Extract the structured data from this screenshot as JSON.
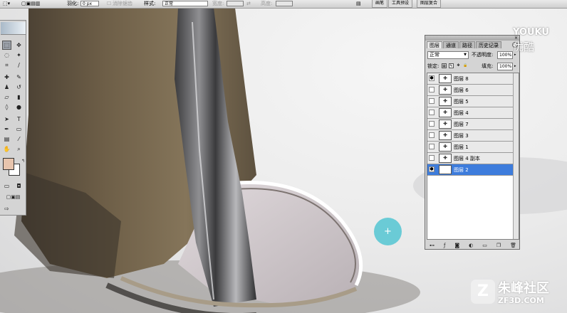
{
  "options_bar": {
    "feather_label": "羽化:",
    "feather_value": "0 px",
    "antialias_label": "消除锯齿",
    "style_label": "样式:",
    "style_value": "正常",
    "width_label": "宽度:",
    "height_label": "高度:"
  },
  "workspace_tabs": [
    "画笔",
    "工具预设",
    "图层复合"
  ],
  "layers_panel": {
    "tabs": [
      "图层",
      "通道",
      "路径",
      "历史记录"
    ],
    "blend_mode": "正常",
    "opacity_label": "不透明度:",
    "opacity_value": "100%",
    "lock_label": "锁定:",
    "fill_label": "填充:",
    "fill_value": "100%",
    "layers": [
      {
        "name": "图层 8",
        "visible": true,
        "selected": false
      },
      {
        "name": "图层 6",
        "visible": false,
        "selected": false
      },
      {
        "name": "图层 5",
        "visible": false,
        "selected": false
      },
      {
        "name": "图层 4",
        "visible": false,
        "selected": false
      },
      {
        "name": "图层 7",
        "visible": false,
        "selected": false
      },
      {
        "name": "图层 3",
        "visible": false,
        "selected": false
      },
      {
        "name": "图层 1",
        "visible": false,
        "selected": false
      },
      {
        "name": "图层 4 副本",
        "visible": false,
        "selected": false
      },
      {
        "name": "图层 2",
        "visible": true,
        "selected": true
      }
    ]
  },
  "tools": {
    "foreground_color": "#e7c4ad",
    "background_color": "#ffffff"
  },
  "watermarks": {
    "youku_line1": "YOUKU",
    "youku_line2": "优酷",
    "site_name": "朱峰社区",
    "site_url": "ZF3D.COM"
  },
  "cursor_symbol": "+"
}
